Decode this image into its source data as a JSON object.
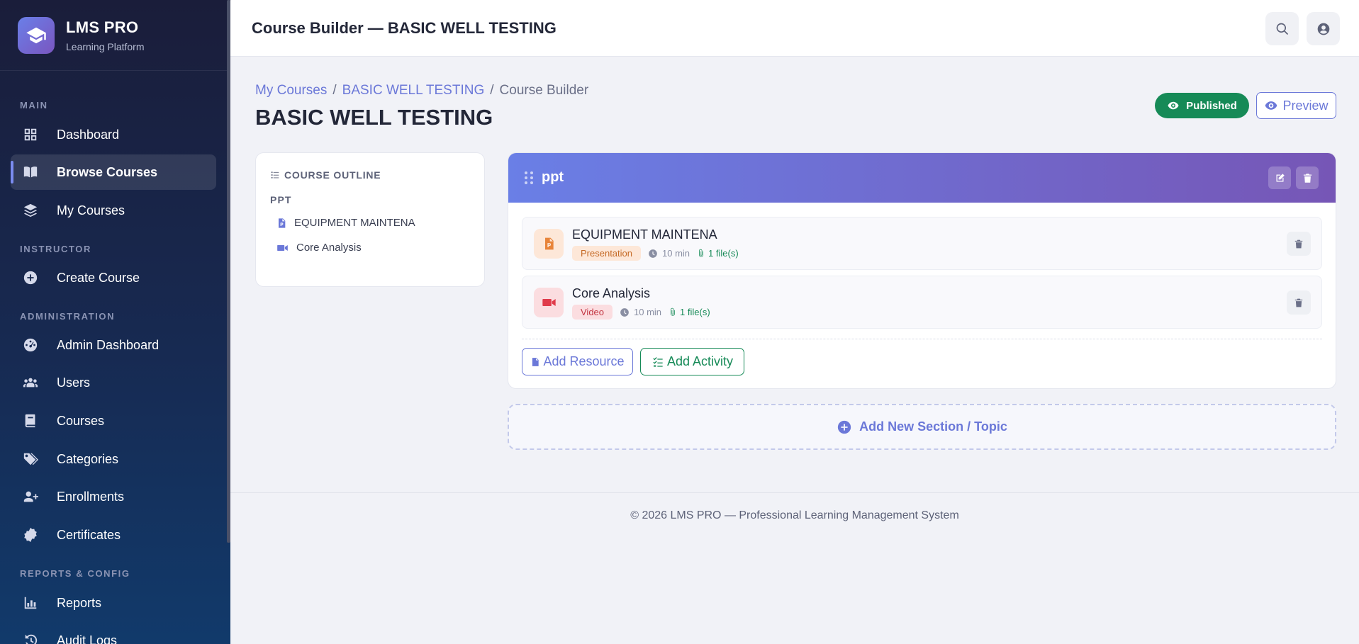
{
  "brand": {
    "name": "LMS PRO",
    "subtitle": "Learning Platform"
  },
  "sidebar": {
    "sections": [
      {
        "label": "MAIN"
      },
      {
        "label": "INSTRUCTOR"
      },
      {
        "label": "ADMINISTRATION"
      },
      {
        "label": "REPORTS & CONFIG"
      }
    ],
    "items": [
      {
        "label": "Dashboard",
        "icon": "grid-icon"
      },
      {
        "label": "Browse Courses",
        "icon": "book-open-icon",
        "active": true
      },
      {
        "label": "My Courses",
        "icon": "layers-icon"
      },
      {
        "label": "Create Course",
        "icon": "plus-circle-icon"
      },
      {
        "label": "Admin Dashboard",
        "icon": "gauge-icon"
      },
      {
        "label": "Users",
        "icon": "users-icon"
      },
      {
        "label": "Courses",
        "icon": "book-icon"
      },
      {
        "label": "Categories",
        "icon": "tags-icon"
      },
      {
        "label": "Enrollments",
        "icon": "user-plus-icon"
      },
      {
        "label": "Certificates",
        "icon": "certificate-icon"
      },
      {
        "label": "Reports",
        "icon": "chart-icon"
      },
      {
        "label": "Audit Logs",
        "icon": "history-icon"
      }
    ]
  },
  "topbar": {
    "title": "Course Builder — BASIC WELL TESTING"
  },
  "breadcrumb": {
    "items": [
      "My Courses",
      "BASIC WELL TESTING",
      "Course Builder"
    ],
    "separator": "/"
  },
  "page": {
    "title": "BASIC WELL TESTING"
  },
  "actions": {
    "published": "Published",
    "preview": "Preview"
  },
  "outline": {
    "heading": "COURSE OUTLINE",
    "section": "PPT",
    "items": [
      {
        "label": "EQUIPMENT MAINTENA",
        "icon": "file-powerpoint-icon"
      },
      {
        "label": "Core Analysis",
        "icon": "video-icon"
      }
    ]
  },
  "section": {
    "name": "ppt",
    "activities": [
      {
        "title": "EQUIPMENT MAINTENA",
        "type": "Presentation",
        "duration": "10 min",
        "files": "1 file(s)",
        "icon": "file-powerpoint-icon",
        "color": "#e8843a"
      },
      {
        "title": "Core Analysis",
        "type": "Video",
        "duration": "10 min",
        "files": "1 file(s)",
        "icon": "video-icon",
        "color": "#e03b4a"
      }
    ],
    "add_resource": "Add Resource",
    "add_activity": "Add Activity"
  },
  "add_section": "Add New Section / Topic",
  "footer": {
    "text": "© 2026 LMS PRO — Professional Learning Management System"
  },
  "colors": {
    "accent": "#6b78d8",
    "success": "#168a57",
    "sidebar": "#1a1d3a"
  }
}
